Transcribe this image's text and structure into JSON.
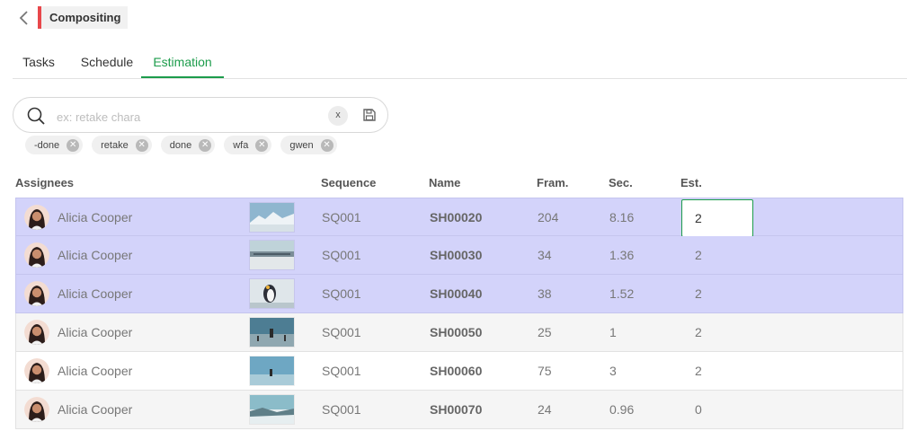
{
  "header": {
    "back_icon": "chevron-left-icon",
    "title": "Compositing",
    "title_accent": "#e8474b"
  },
  "tabs": [
    {
      "label": "Tasks",
      "active": false
    },
    {
      "label": "Schedule",
      "active": false
    },
    {
      "label": "Estimation",
      "active": true
    }
  ],
  "search": {
    "placeholder": "ex: retake chara",
    "value": "",
    "clear_label": "x",
    "icon": "search-icon",
    "save_icon": "save-icon"
  },
  "filters": [
    {
      "label": "-done"
    },
    {
      "label": "retake"
    },
    {
      "label": "done"
    },
    {
      "label": "wfa"
    },
    {
      "label": "gwen"
    }
  ],
  "columns": {
    "assignees": "Assignees",
    "sequence": "Sequence",
    "name": "Name",
    "frames": "Fram.",
    "seconds": "Sec.",
    "estimation": "Est."
  },
  "rows": [
    {
      "assignee": "Alicia Cooper",
      "sequence": "SQ001",
      "name": "SH00020",
      "frames": "204",
      "seconds": "8.16",
      "estimation": "2",
      "selected": true,
      "editing": true,
      "thumb": "snowy-mountains"
    },
    {
      "assignee": "Alicia Cooper",
      "sequence": "SQ001",
      "name": "SH00030",
      "frames": "34",
      "seconds": "1.36",
      "estimation": "2",
      "selected": true,
      "thumb": "shoreline"
    },
    {
      "assignee": "Alicia Cooper",
      "sequence": "SQ001",
      "name": "SH00040",
      "frames": "38",
      "seconds": "1.52",
      "estimation": "2",
      "selected": true,
      "thumb": "penguin"
    },
    {
      "assignee": "Alicia Cooper",
      "sequence": "SQ001",
      "name": "SH00050",
      "frames": "25",
      "seconds": "1",
      "estimation": "2",
      "selected": false,
      "thumb": "coast-figure"
    },
    {
      "assignee": "Alicia Cooper",
      "sequence": "SQ001",
      "name": "SH00060",
      "frames": "75",
      "seconds": "3",
      "estimation": "2",
      "selected": false,
      "thumb": "blue-sea"
    },
    {
      "assignee": "Alicia Cooper",
      "sequence": "SQ001",
      "name": "SH00070",
      "frames": "24",
      "seconds": "0.96",
      "estimation": "0",
      "selected": false,
      "thumb": "icy-shore"
    }
  ],
  "colors": {
    "accent": "#1c9c4b",
    "selected_row": "#d3d3fa"
  }
}
